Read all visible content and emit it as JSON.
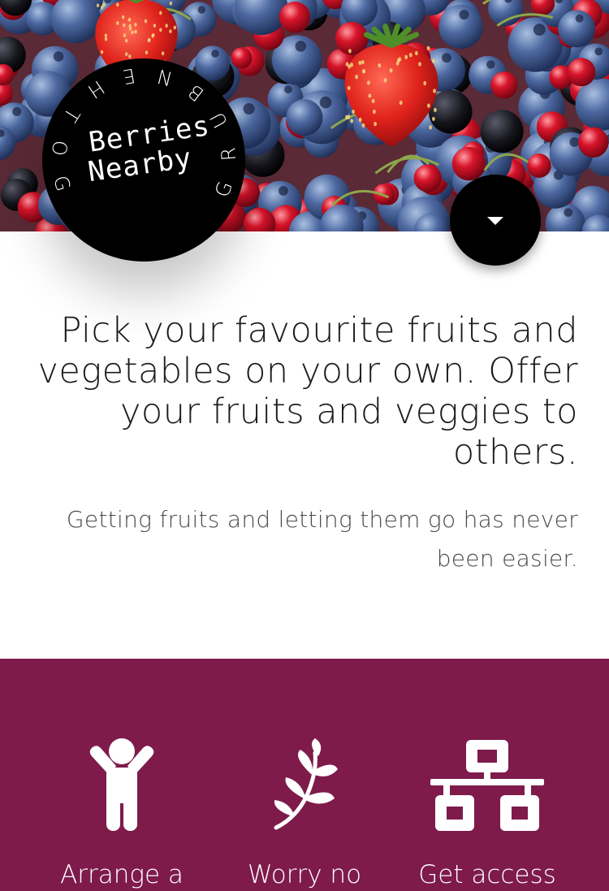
{
  "hero": {
    "image": "mixed berries photo: strawberries, blueberries, red currants, blackberries"
  },
  "logo": {
    "name_line1": "Berries",
    "name_line2": "Nearby",
    "ring_text": "GOTHENBURG"
  },
  "scroll_button": {
    "icon": "caret-down-icon"
  },
  "intro": {
    "headline": "Pick your favourite fruits and vegetables on your own. Offer your fruits and veggies to others.",
    "subline": "Getting fruits and letting them go has never been easier."
  },
  "features": {
    "items": [
      {
        "icon": "child-icon",
        "label": "Arrange a"
      },
      {
        "icon": "leaf-branch-icon",
        "label": "Worry no"
      },
      {
        "icon": "network-icon",
        "label": "Get access"
      }
    ]
  },
  "colors": {
    "feature_band": "#7e1b4b",
    "logo_bg": "#000000",
    "text_dark": "#1b1b1b"
  }
}
